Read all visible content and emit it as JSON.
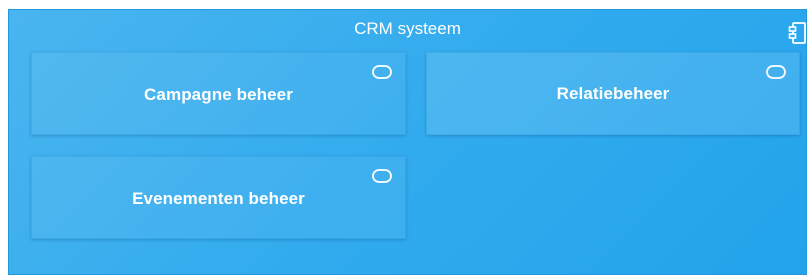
{
  "system": {
    "title": "CRM systeem",
    "icon": "component-icon"
  },
  "modules": [
    {
      "label": "Campagne beheer",
      "icon": "rounded-rectangle-icon"
    },
    {
      "label": "Relatiebeheer",
      "icon": "rounded-rectangle-icon"
    },
    {
      "label": "Evenementen beheer",
      "icon": "rounded-rectangle-icon"
    }
  ],
  "colors": {
    "background": "#34acee",
    "text": "#ffffff"
  }
}
